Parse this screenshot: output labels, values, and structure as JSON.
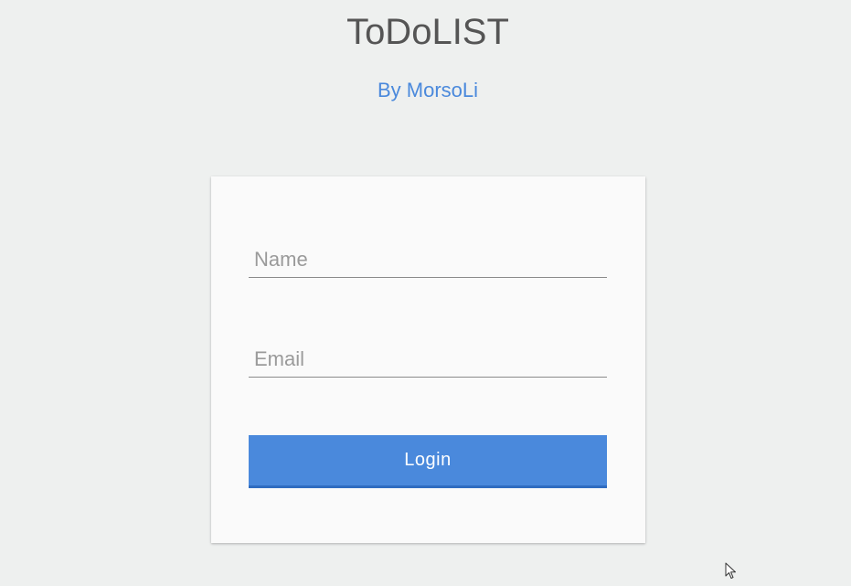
{
  "header": {
    "title": "ToDoLIST",
    "subtitle": "By MorsoLi"
  },
  "form": {
    "name_placeholder": "Name",
    "name_value": "",
    "email_placeholder": "Email",
    "email_value": "",
    "login_label": "Login"
  },
  "colors": {
    "background": "#eef0ef",
    "card": "#fafafa",
    "accent": "#4a89dc",
    "accent_dark": "#2f6cc0",
    "title_text": "#555555"
  },
  "icons": {
    "cursor": "mouse-pointer-icon"
  }
}
